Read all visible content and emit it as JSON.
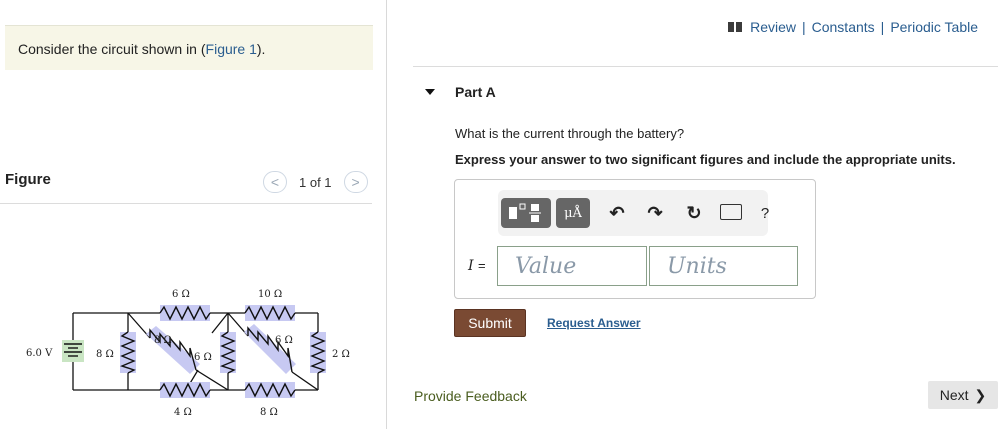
{
  "intro": {
    "text": "Consider the circuit shown in (",
    "link": "Figure 1",
    "suffix": ")."
  },
  "figure": {
    "title": "Figure",
    "nav": {
      "prev": "<",
      "count": "1 of 1",
      "next": ">"
    },
    "labels": {
      "battery": "6.0 V",
      "r_left": "8 Ω",
      "r_top1": "6 Ω",
      "r_top2": "10 Ω",
      "r_diag1": "8 Ω",
      "r_diag2": "6 Ω",
      "r_diag3": "6 Ω",
      "r_right": "2 Ω",
      "r_bot1": "4 Ω",
      "r_bot2": "8 Ω"
    }
  },
  "toplinks": {
    "review": "Review",
    "sep1": "|",
    "constants": "Constants",
    "sep2": "|",
    "periodic": "Periodic Table"
  },
  "part": {
    "title": "Part A"
  },
  "question": "What is the current through the battery?",
  "instruction": "Express your answer to two significant figures and include the appropriate units.",
  "answer": {
    "variable": "I",
    "equals": "=",
    "value_placeholder": "Value",
    "units_placeholder": "Units",
    "units_button": "μÅ",
    "help": "?"
  },
  "actions": {
    "submit": "Submit",
    "request": "Request Answer"
  },
  "footer": {
    "feedback": "Provide Feedback",
    "next": "Next"
  }
}
